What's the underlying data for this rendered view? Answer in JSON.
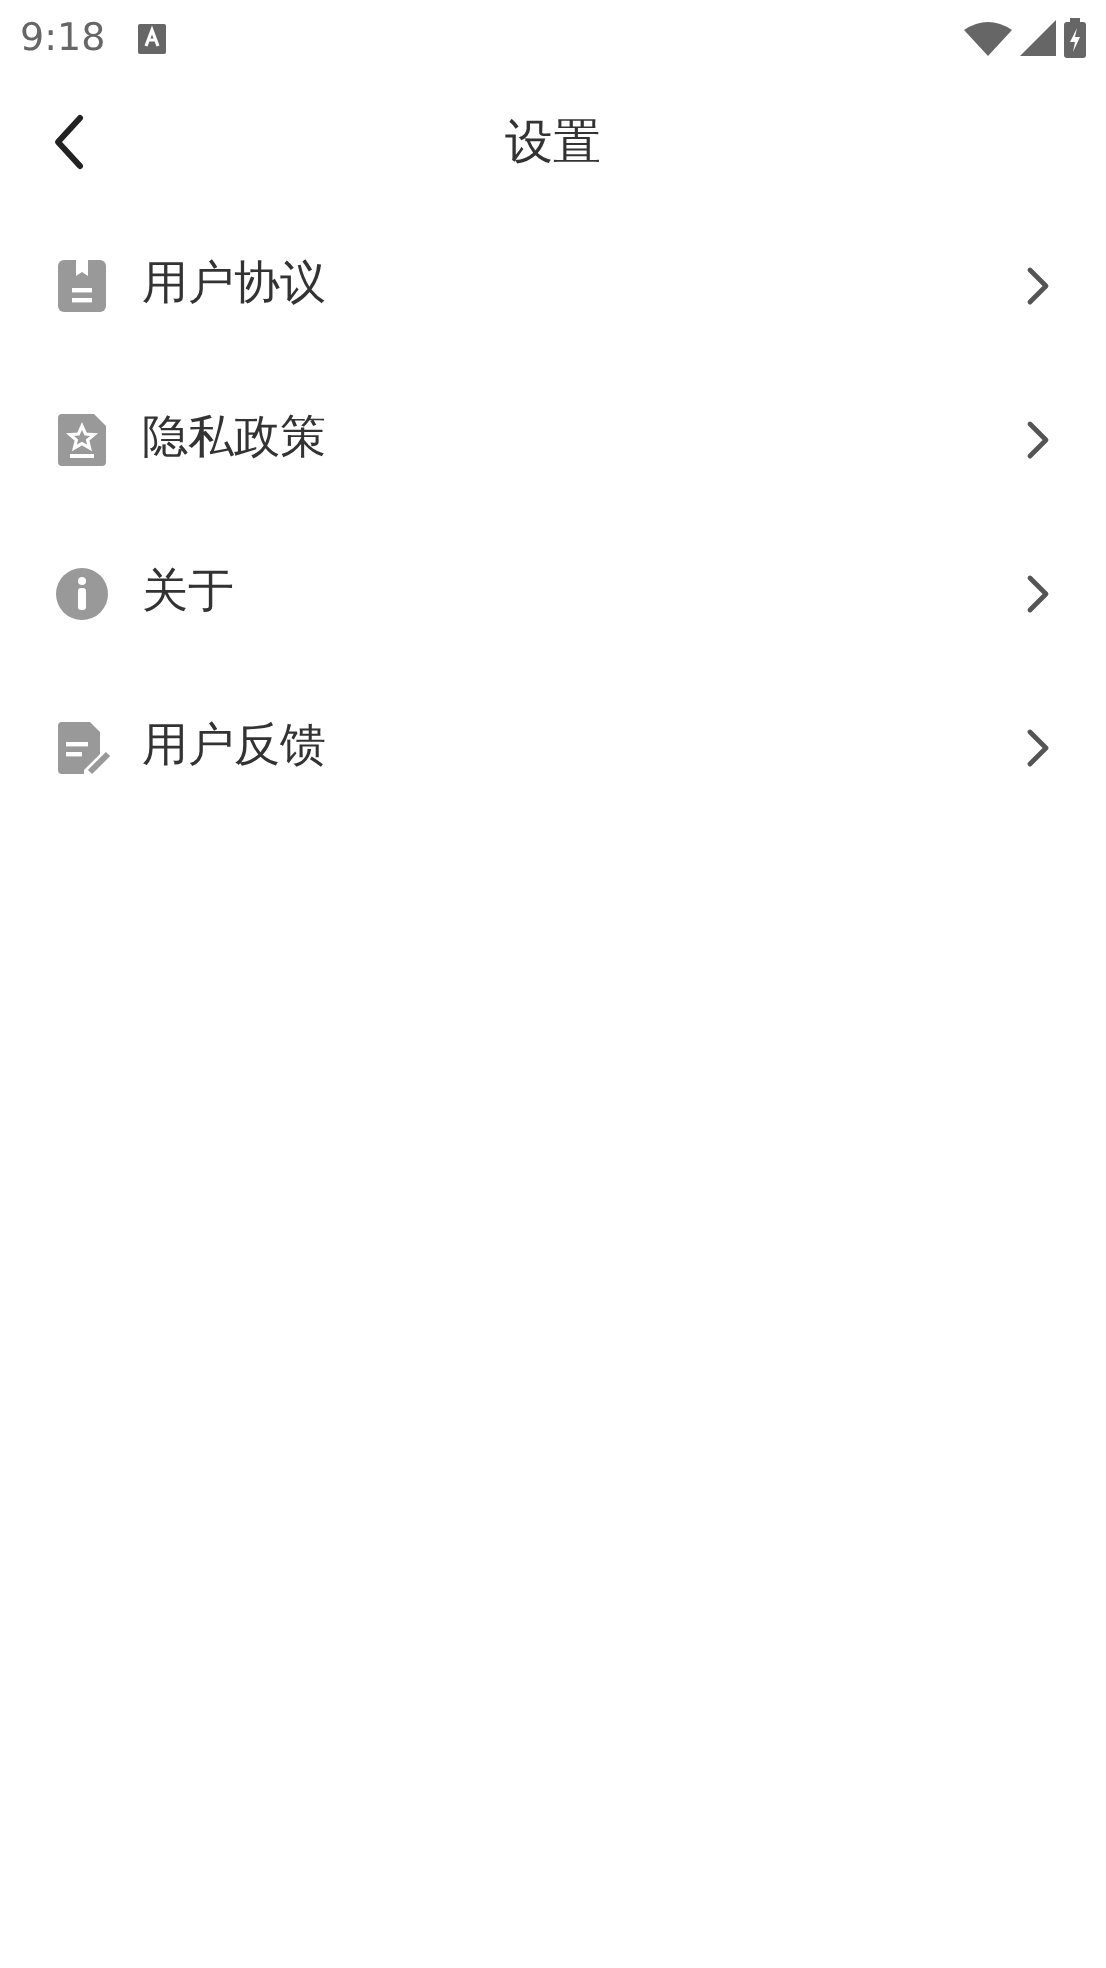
{
  "status_bar": {
    "time": "9:18"
  },
  "header": {
    "title": "设置"
  },
  "items": [
    {
      "label": "用户协议",
      "kind": "agreement"
    },
    {
      "label": "隐私政策",
      "kind": "privacy"
    },
    {
      "label": "关于",
      "kind": "about"
    },
    {
      "label": "用户反馈",
      "kind": "feedback"
    }
  ]
}
